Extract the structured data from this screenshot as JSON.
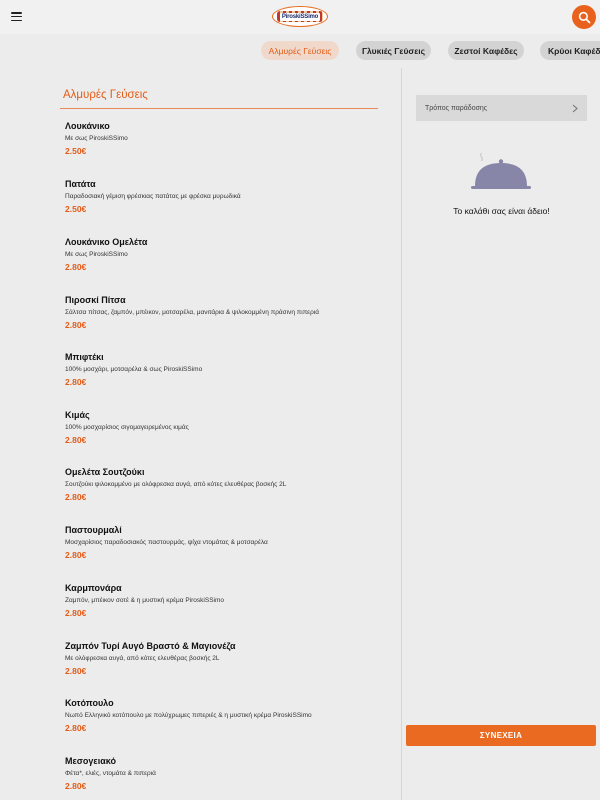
{
  "header": {
    "logo_text": "PiroskiSSimo",
    "menu_icon": "hamburger-icon",
    "search_icon": "search-icon"
  },
  "tabs": [
    {
      "label": "Αλμυρές Γεύσεις",
      "active": true
    },
    {
      "label": "Γλυκιές Γεύσεις",
      "active": false
    },
    {
      "label": "Ζεστοί Καφέδες",
      "active": false
    },
    {
      "label": "Κρύοι Καφέδες",
      "active": false
    }
  ],
  "menu": {
    "section_title": "Αλμυρές Γεύσεις",
    "items": [
      {
        "name": "Λουκάνικο",
        "desc": "Με σως PiroskiSSimo",
        "price": "2.50€"
      },
      {
        "name": "Πατάτα",
        "desc": "Παραδοσιακή γέμιση φρέσκιας πατάτας με φρέσκα μυρωδικά",
        "price": "2.50€"
      },
      {
        "name": "Λουκάνικο Ομελέτα",
        "desc": "Με σως PiroskiSSimo",
        "price": "2.80€"
      },
      {
        "name": "Πιροσκί Πίτσα",
        "desc": "Σάλτσα πίτσας, ζαμπόν, μπέικον, μοτσαρέλα, μανιτάρια & ψιλοκομμένη πράσινη πιπεριά",
        "price": "2.80€"
      },
      {
        "name": "Μπιφτέκι",
        "desc": "100% μοσχάρι, μοτσαρέλα & σως PiroskiSSimo",
        "price": "2.80€"
      },
      {
        "name": "Κιμάς",
        "desc": "100% μοσχαρίσιος σιγομαγειρεμένος κιμάς",
        "price": "2.80€"
      },
      {
        "name": "Ομελέτα Σουτζούκι",
        "desc": "Σουτζούκι ψιλοκομμένο με ολόφρεσκα αυγά, από κότες ελευθέρας βοσκής 2L",
        "price": "2.80€"
      },
      {
        "name": "Παστουρμαλί",
        "desc": "Μοσχαρίσιος παραδοσιακός παστουρμάς, ψίχα ντομάτας & μοτσαρέλα",
        "price": "2.80€"
      },
      {
        "name": "Καρμπονάρα",
        "desc": "Ζαμπόν, μπέικον σοτέ & η μυστική κρέμα PiroskiSSimo",
        "price": "2.80€"
      },
      {
        "name": "Ζαμπόν Τυρί Αυγό Βραστό & Μαγιονέζα",
        "desc": "Με ολόφρεσκα αυγά, από κότες ελευθέρας βοσκής 2L",
        "price": "2.80€"
      },
      {
        "name": "Κοτόπουλο",
        "desc": "Νωπό Ελληνικό κοτόπουλο με πολύχρωμες πιπεριές & η μυστική κρέμα PiroskiSSimo",
        "price": "2.80€"
      },
      {
        "name": "Μεσογειακό",
        "desc": "Φέτα*, ελιές, ντομάτα & πιπεριά",
        "price": "2.80€"
      }
    ]
  },
  "cart": {
    "delivery_label": "Τρόπος παράδοσης",
    "empty_message": "Το καλάθι σας είναι άδειο!",
    "continue_label": "ΣΥΝΕΧΕΙΑ",
    "cloche_icon": "cloche-icon"
  },
  "colors": {
    "accent": "#e35b17",
    "button": "#ea6a22",
    "active_tab_bg": "#f0d9cb",
    "cloche": "#8785a8"
  }
}
